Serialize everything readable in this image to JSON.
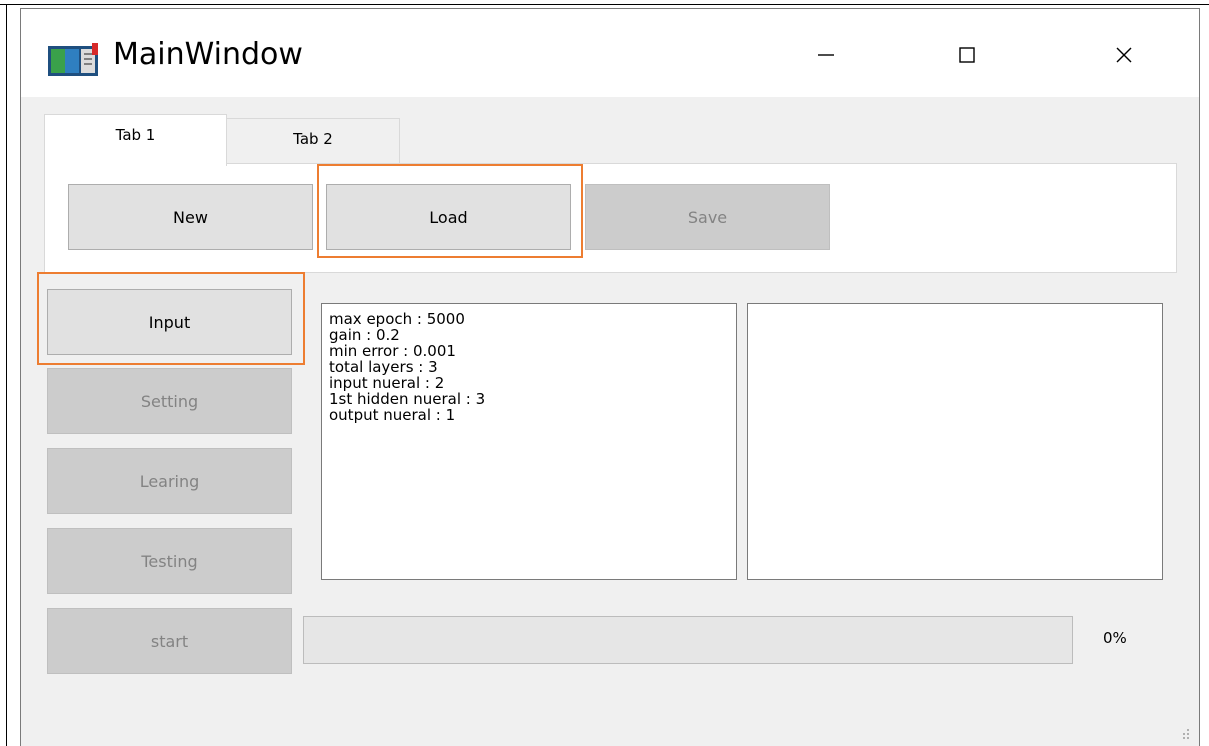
{
  "window": {
    "title": "MainWindow",
    "app_icon": "window-app-icon",
    "controls": {
      "minimize": "minimize-icon",
      "maximize": "maximize-icon",
      "close": "close-icon"
    }
  },
  "tabs": [
    {
      "label": "Tab 1",
      "selected": true
    },
    {
      "label": "Tab 2",
      "selected": false
    }
  ],
  "toolbar": {
    "new_label": "New",
    "load_label": "Load",
    "save_label": "Save"
  },
  "side_buttons": {
    "input_label": "Input",
    "setting_label": "Setting",
    "learning_label": "Learing",
    "testing_label": "Testing",
    "start_label": "start"
  },
  "info_text": [
    "max epoch : 5000",
    "gain : 0.2",
    "min error : 0.001",
    "total layers : 3",
    "input nueral : 2",
    "1st hidden nueral : 3",
    "output nueral : 1"
  ],
  "output_text": "",
  "progress": {
    "value": 0,
    "label": "0%"
  },
  "colors": {
    "highlight": "#ed7d31",
    "button": "#e1e1e1",
    "disabled_button": "#cccccc",
    "window_bg": "#f0f0f0"
  }
}
